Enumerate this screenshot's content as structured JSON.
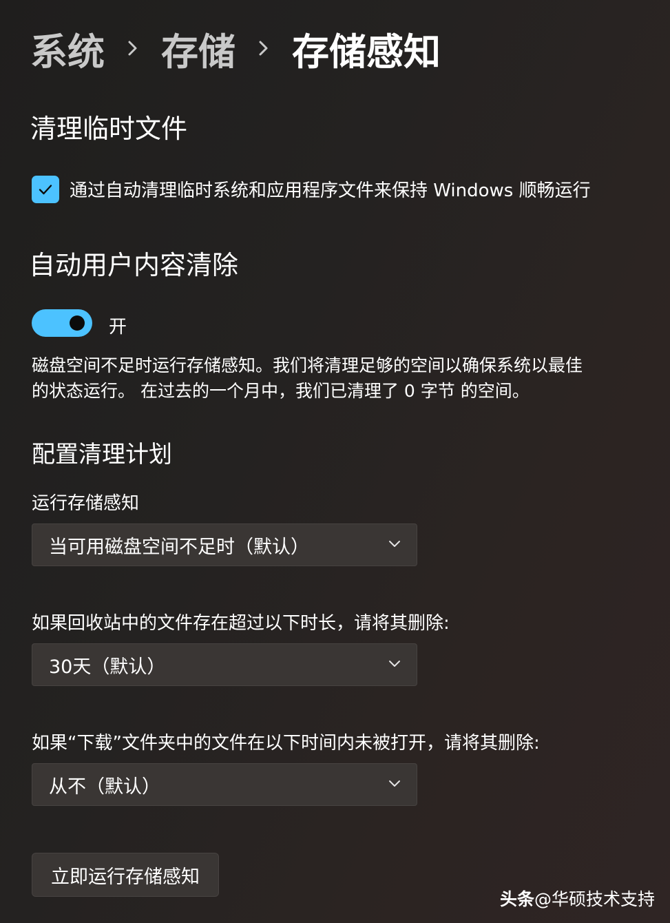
{
  "breadcrumb": {
    "items": [
      "系统",
      "存储",
      "存储感知"
    ]
  },
  "temp_files": {
    "title": "清理临时文件",
    "checkbox_label": "通过自动清理临时系统和应用程序文件来保持 Windows 顺畅运行",
    "checked": true
  },
  "auto_cleanup": {
    "title": "自动用户内容清除",
    "toggle_label": "开",
    "toggle_on": true,
    "description_line1": "磁盘空间不足时运行存储感知。我们将清理足够的空间以确保系统以最佳",
    "description_line2": "的状态运行。 在过去的一个月中，我们已清理了 0 字节 的空间。"
  },
  "schedule": {
    "title": "配置清理计划",
    "run_label": "运行存储感知",
    "run_value": "当可用磁盘空间不足时（默认）",
    "recycle_label": "如果回收站中的文件存在超过以下时长，请将其删除:",
    "recycle_value": "30天（默认）",
    "downloads_label": "如果“下载”文件夹中的文件在以下时间内未被打开，请将其删除:",
    "downloads_value": "从不（默认）"
  },
  "run_now_button": "立即运行存储感知",
  "watermark": {
    "brand": "头条",
    "handle": "@华硕技术支持"
  },
  "colors": {
    "accent": "#4cc2ff",
    "background": "#242221",
    "control": "#3a3634"
  }
}
